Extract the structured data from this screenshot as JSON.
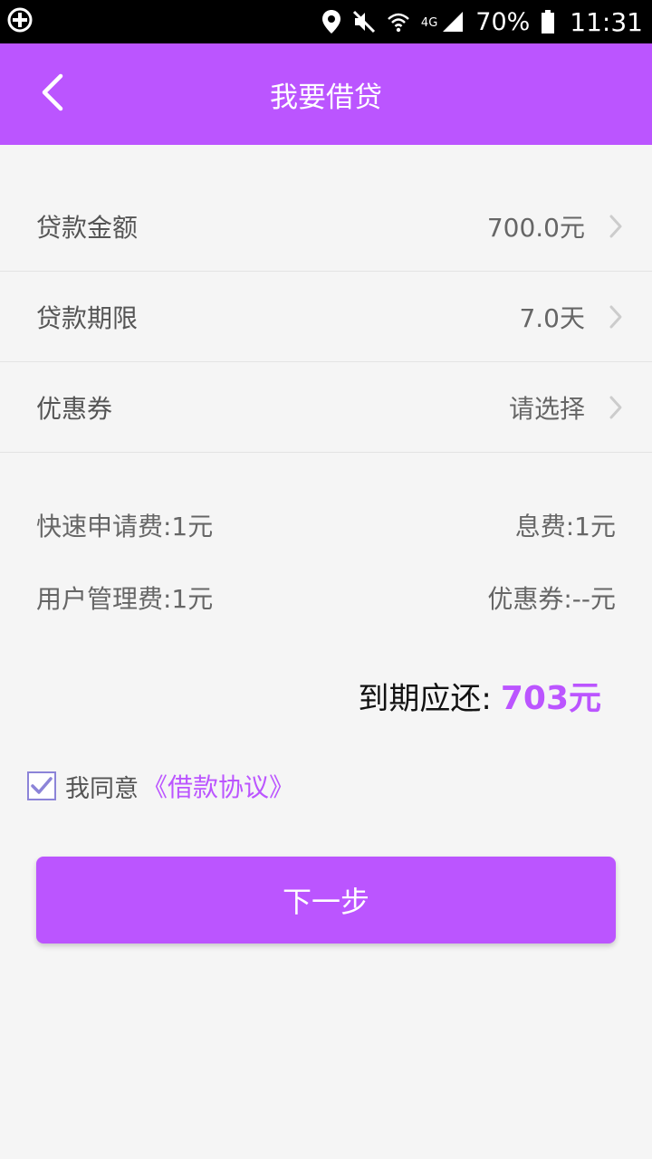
{
  "status_bar": {
    "battery": "70%",
    "time": "11:31",
    "network": "4G"
  },
  "header": {
    "title": "我要借贷"
  },
  "form": {
    "rows": [
      {
        "label": "贷款金额",
        "value": "700.0元"
      },
      {
        "label": "贷款期限",
        "value": "7.0天"
      },
      {
        "label": "优惠券",
        "value": "请选择"
      }
    ]
  },
  "fees": {
    "quick_apply": "快速申请费:1元",
    "interest": "息费:1元",
    "user_management": "用户管理费:1元",
    "coupon": "优惠券:--元"
  },
  "total": {
    "label": "到期应还:",
    "amount": "703元"
  },
  "agreement": {
    "checked": true,
    "text": "我同意",
    "link": "《借款协议》"
  },
  "next_button": {
    "label": "下一步"
  },
  "colors": {
    "accent": "#bb55ff",
    "background": "#f5f5f5",
    "checkbox_border": "#8c84d8"
  }
}
